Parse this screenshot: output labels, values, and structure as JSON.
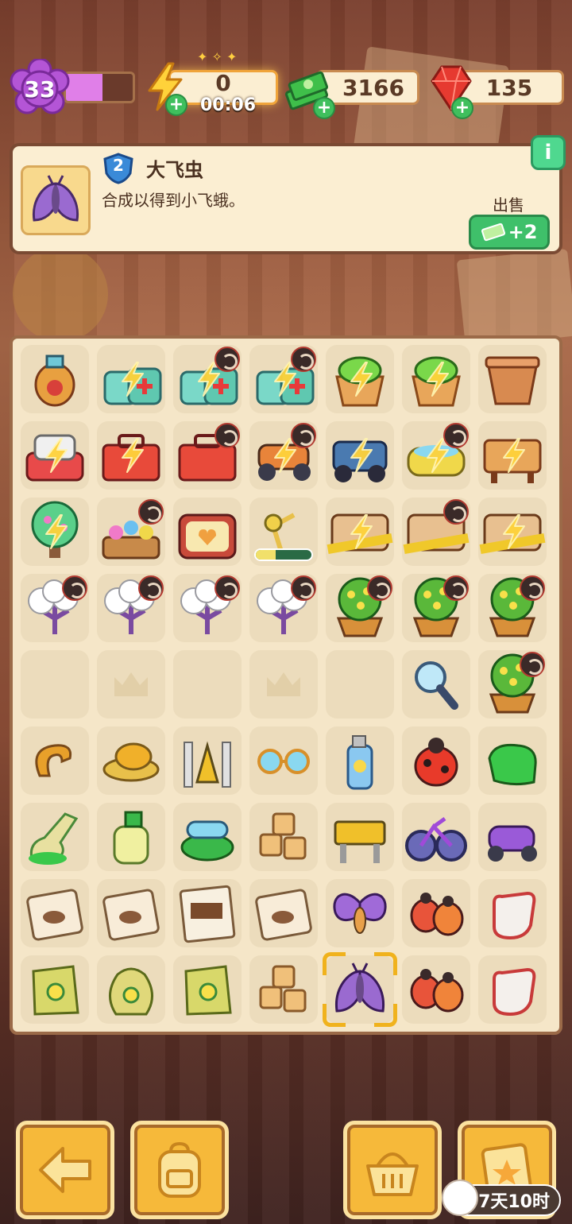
{
  "status_bar": {
    "level": "33",
    "level_progress": 0.55,
    "energy": "0",
    "energy_timer": "00:06",
    "money": "3166",
    "gems": "135"
  },
  "info_panel": {
    "item_level": "2",
    "item_name": "大飞虫",
    "item_desc": "合成以得到小飞蛾。",
    "info_button": "i",
    "sell_label": "出售",
    "sell_value": "+2"
  },
  "board": {
    "rows": [
      [
        {
          "item": "dragon-vase-icon"
        },
        {
          "item": "medical-kit-icon",
          "energy": true
        },
        {
          "item": "medical-kit-icon",
          "energy": true,
          "locked": true
        },
        {
          "item": "medical-kit-icon",
          "energy": true,
          "locked": true
        },
        {
          "item": "plant-pot-icon",
          "energy": true
        },
        {
          "item": "plant-pot-icon",
          "energy": true
        },
        {
          "item": "clay-pot-icon"
        }
      ],
      [
        {
          "item": "sewing-machine-icon",
          "energy": true
        },
        {
          "item": "toolbox-icon",
          "energy": true
        },
        {
          "item": "toolbox-icon",
          "locked": true
        },
        {
          "item": "go-kart-icon",
          "energy": true,
          "locked": true
        },
        {
          "item": "jeep-icon",
          "energy": true
        },
        {
          "item": "bathtub-icon",
          "energy": true,
          "locked": true
        },
        {
          "item": "wooden-desk-icon",
          "energy": true
        }
      ],
      [
        {
          "item": "bonsai-tree-icon",
          "energy": true
        },
        {
          "item": "flower-bed-icon",
          "locked": true
        },
        {
          "item": "retro-tv-icon"
        },
        {
          "item": "desk-lamp-icon",
          "progress": 0.35
        },
        {
          "item": "crime-scene-icon",
          "energy": true
        },
        {
          "item": "crime-scene-icon",
          "locked": true
        },
        {
          "item": "crime-scene-icon",
          "energy": true
        }
      ],
      [
        {
          "item": "cotton-flower-icon",
          "locked": true
        },
        {
          "item": "cotton-flower-icon",
          "locked": true
        },
        {
          "item": "cotton-flower-icon",
          "locked": true
        },
        {
          "item": "cotton-flower-icon",
          "locked": true
        },
        {
          "item": "flower-bush-icon",
          "locked": true
        },
        {
          "item": "flower-bush-icon",
          "locked": true
        },
        {
          "item": "flower-bush-icon",
          "locked": true
        }
      ],
      [
        {
          "item": "empty"
        },
        {
          "item": "empty-crown"
        },
        {
          "item": "empty"
        },
        {
          "item": "empty-crown"
        },
        {
          "item": "empty"
        },
        {
          "item": "magnifier-icon"
        },
        {
          "item": "flower-bush-icon",
          "locked": true
        }
      ],
      [
        {
          "item": "neck-pillow-icon"
        },
        {
          "item": "hat-icon"
        },
        {
          "item": "caution-cone-icon"
        },
        {
          "item": "sunglasses-icon"
        },
        {
          "item": "sunscreen-spray-icon"
        },
        {
          "item": "ladybug-icon"
        },
        {
          "item": "green-cloth-icon"
        }
      ],
      [
        {
          "item": "slipper-icon"
        },
        {
          "item": "lotion-bottle-icon"
        },
        {
          "item": "goggles-icon"
        },
        {
          "item": "tofu-cubes-icon"
        },
        {
          "item": "danger-barrier-icon"
        },
        {
          "item": "bicycle-icon"
        },
        {
          "item": "scooter-icon"
        }
      ],
      [
        {
          "item": "evidence-bag-icon"
        },
        {
          "item": "evidence-bag-icon"
        },
        {
          "item": "wanted-poster-icon"
        },
        {
          "item": "evidence-bag-icon"
        },
        {
          "item": "moth-icon"
        },
        {
          "item": "ladybug-pair-icon"
        },
        {
          "item": "glove-icon"
        }
      ],
      [
        {
          "item": "seed-bag-icon"
        },
        {
          "item": "seed-sack-icon"
        },
        {
          "item": "seed-bag-icon"
        },
        {
          "item": "tofu-cubes-icon"
        },
        {
          "item": "big-moth-icon",
          "selected": true
        },
        {
          "item": "ladybug-pair-icon"
        },
        {
          "item": "glove-icon"
        }
      ]
    ]
  },
  "bottom_bar": {
    "buttons": [
      "back-arrow-icon",
      "backpack-icon",
      "basket-icon",
      "clipboard-star-icon"
    ],
    "event_timer": "7天10时"
  }
}
